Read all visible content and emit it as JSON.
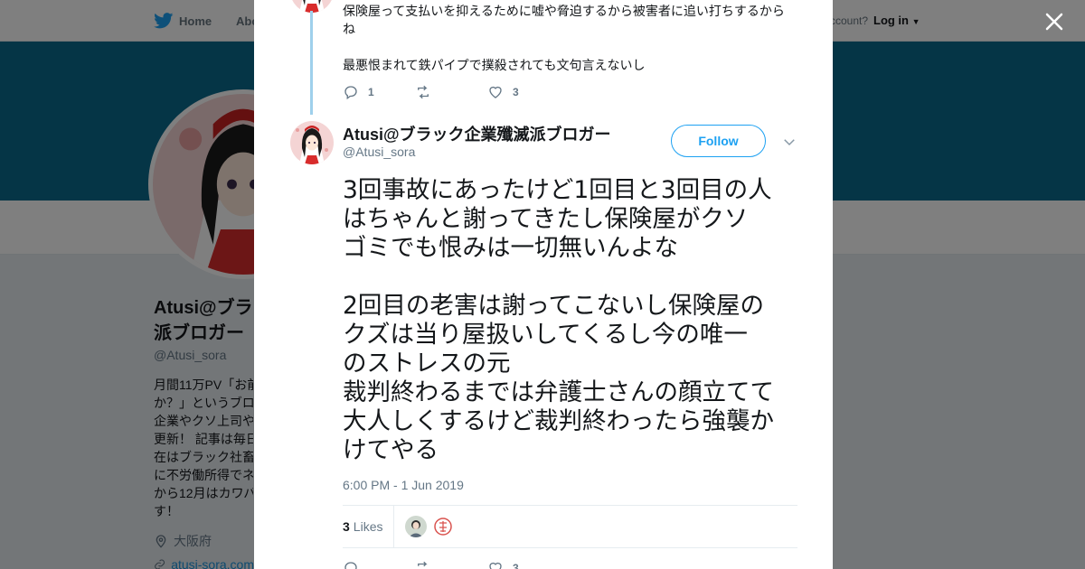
{
  "background": {
    "nav": {
      "home_label": "Home",
      "about_label": "Abo",
      "account_prompt": "ccount?",
      "login_label": "Log in"
    },
    "profile": {
      "name_line1": "Atusi@ブラ",
      "name_line2": "派ブロガー",
      "handle": "@Atusi_sora",
      "bio_lines": [
        "月間11万PV「お前",
        "か？」というブロ",
        "企業やクソ上司や",
        "更新！ 記事は毎日",
        "在はブラック社畜",
        "に不労働所得でネ",
        "から12月はカワバ",
        "す！"
      ],
      "location": "大阪府",
      "url": "atusi-sora.com"
    }
  },
  "modal": {
    "previous_tweet": {
      "lines": [
        "保険屋って支払いを抑えるために嘘や脅迫するから被害者に追い打ちするから",
        "ね",
        "",
        "最悪恨まれて鉄パイプで撲殺されても文句言えないし"
      ],
      "replies": "1",
      "retweets": "",
      "likes": "3"
    },
    "tweet": {
      "author_name": "Atusi@ブラック企業殲滅派ブロガー",
      "author_handle": "@Atusi_sora",
      "follow_label": "Follow",
      "paragraph1": [
        "3回事故にあったけど1回目と3回目の人",
        "はちゃんと謝ってきたし保険屋がクソ",
        "ゴミでも恨みは一切無いんよな"
      ],
      "paragraph2": [
        "2回目の老害は謝ってこないし保険屋の",
        "クズは当り屋扱いしてくるし今の唯一",
        "のストレスの元",
        "裁判終わるまでは弁護士さんの顔立てて",
        "大人しくするけど裁判終わったら強襲か",
        "けてやる"
      ],
      "timestamp": "6:00 PM - 1 Jun 2019",
      "likes_count": "3",
      "likes_label": "Likes",
      "footer_replies": "",
      "footer_retweets": "",
      "footer_likes": "3"
    }
  },
  "colors": {
    "brand_blue": "#1da1f2",
    "banner": "#0b6a8c",
    "thread_line": "#9fd0ec",
    "muted_text": "#657786"
  }
}
